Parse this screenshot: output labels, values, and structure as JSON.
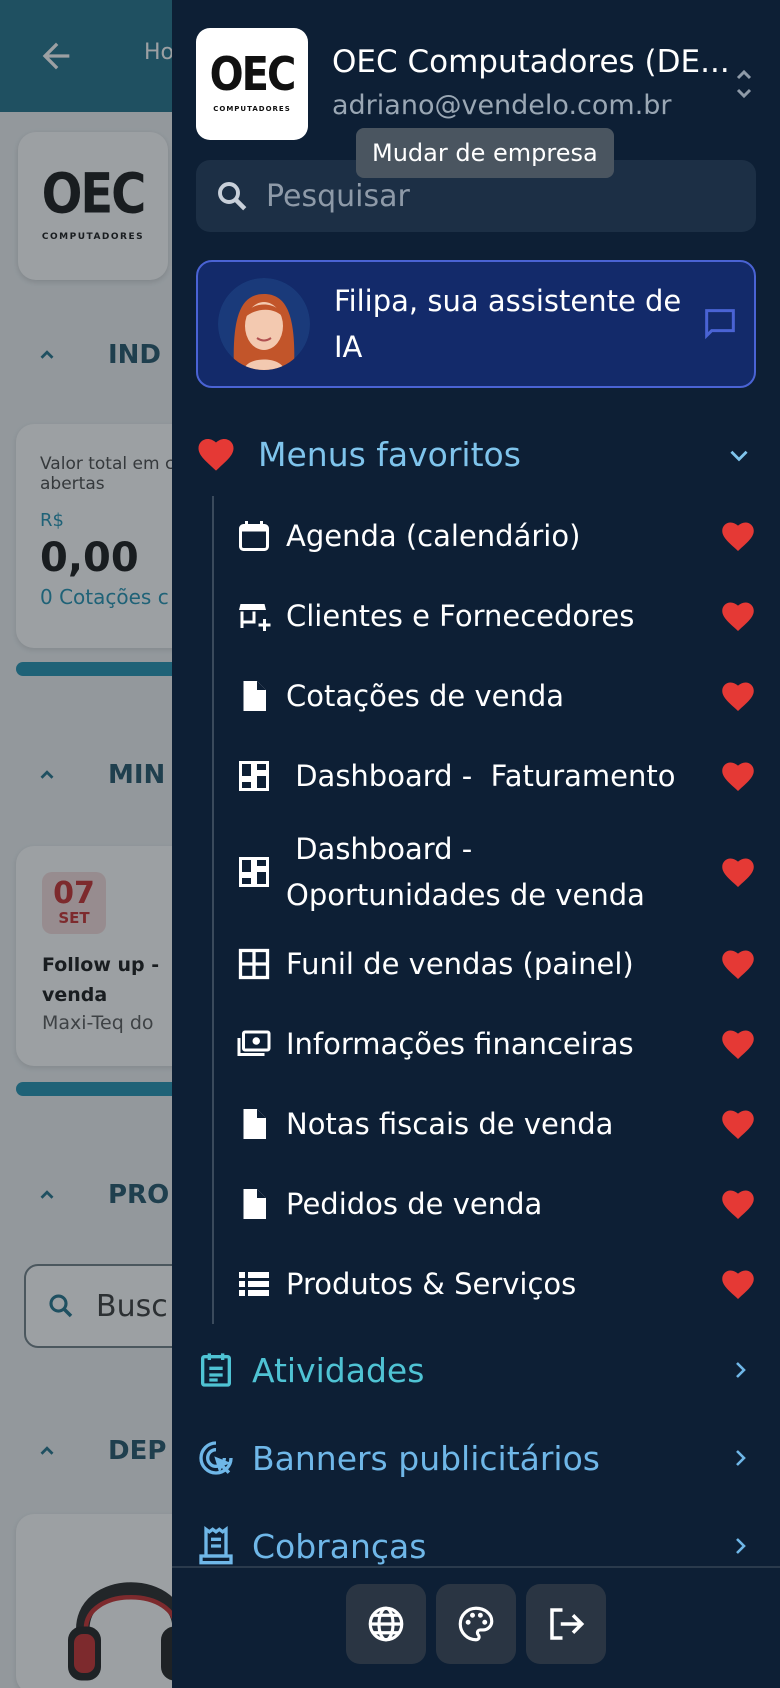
{
  "background_app": {
    "top_title": "Ho",
    "logo_big": "OEC",
    "logo_small": "COMPUTADORES",
    "section1": "IND",
    "card1_label": "Valor total em c abertas",
    "card1_currency": "R$",
    "card1_value": "0,00",
    "card1_sub": "0 Cotações c",
    "section2": "MIN",
    "event_day": "07",
    "event_month": "SET",
    "event_title": "Follow up - venda",
    "event_client": "Maxi-Teq do",
    "section3": "PRO",
    "search_placeholder": "Busc",
    "section4": "DEP"
  },
  "drawer": {
    "logo_big": "OEC",
    "logo_small": "COMPUTADORES",
    "company_name": "OEC Computadores (DE...",
    "company_email": "adriano@vendelo.com.br",
    "tooltip": "Mudar de empresa",
    "search_placeholder": "Pesquisar",
    "ai_label": "Filipa, sua assistente de IA",
    "favorites_title": "Menus favoritos",
    "favorites": [
      {
        "label": "Agenda (calendário)",
        "icon": "calendar-icon"
      },
      {
        "label": "Clientes e Fornecedores",
        "icon": "store-add-icon"
      },
      {
        "label": "Cotações de venda",
        "icon": "document-icon"
      },
      {
        "label": " Dashboard -  Faturamento",
        "icon": "dashboard-icon"
      },
      {
        "label": " Dashboard -  Oportunidades de venda",
        "icon": "dashboard-icon"
      },
      {
        "label": "Funil de vendas (painel)",
        "icon": "grid-icon"
      },
      {
        "label": "Informações financeiras",
        "icon": "money-icon"
      },
      {
        "label": "Notas fiscais de venda",
        "icon": "document-icon"
      },
      {
        "label": "Pedidos de venda",
        "icon": "document-icon"
      },
      {
        "label": "Produtos & Serviços",
        "icon": "list-icon"
      }
    ],
    "menus": [
      {
        "label": "Atividades",
        "icon": "activities-icon",
        "color": "#4fc3d4"
      },
      {
        "label": "Banners publicitários",
        "icon": "target-click-icon",
        "color": "#6fb7e8"
      },
      {
        "label": "Cobranças",
        "icon": "receipt-icon",
        "color": "#6fb7e8"
      }
    ],
    "footer_buttons": [
      "globe-icon",
      "palette-icon",
      "logout-icon"
    ]
  },
  "colors": {
    "drawer_bg": "#0d1f35",
    "accent_blue": "#7fc4ec",
    "heart_red": "#e53935",
    "ai_card_bg": "#132a6a",
    "topbar_teal": "#1d6e88"
  }
}
